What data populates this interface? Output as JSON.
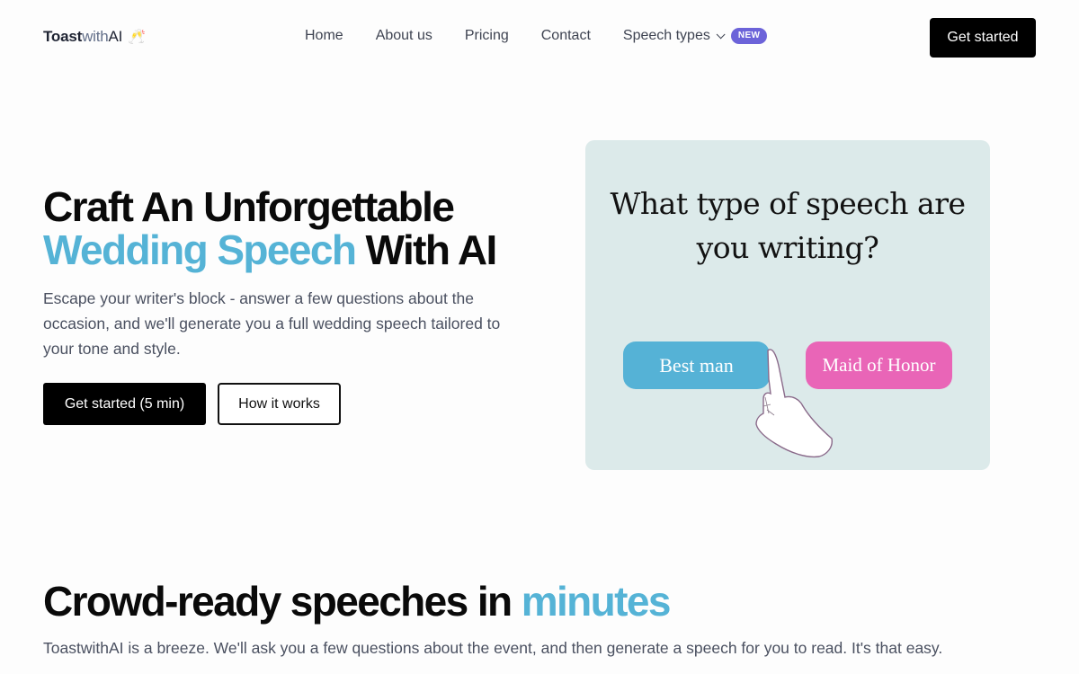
{
  "nav": {
    "logo": {
      "part1": "Toast",
      "part2": "with",
      "part3": "AI",
      "emoji": "🥂"
    },
    "links": [
      {
        "label": "Home"
      },
      {
        "label": "About us"
      },
      {
        "label": "Pricing"
      },
      {
        "label": "Contact"
      },
      {
        "label": "Speech types",
        "badge": "NEW",
        "has_dropdown": true
      }
    ],
    "cta_label": "Get started"
  },
  "hero": {
    "title_line1": "Craft An Unforgettable",
    "title_accent": "Wedding Speech",
    "title_line2_rest": " With AI",
    "subtitle": "Escape your writer's block - answer a few questions about the occasion, and we'll generate you a full wedding speech tailored to your tone and style.",
    "primary_button": "Get started (5 min)",
    "secondary_button": "How it works"
  },
  "illustration": {
    "question_line1": "What type of speech are",
    "question_line2": "you writing?",
    "choices": [
      {
        "label": "Best man",
        "color": "#55b2d6"
      },
      {
        "label": "Maid of Honor",
        "color": "#e965b7"
      }
    ],
    "background": "#dceaea"
  },
  "section2": {
    "title": "Crowd-ready speeches in ",
    "title_accent": "minutes",
    "subtitle": "ToastwithAI is a breeze. We'll ask you a few questions about the event, and then generate a speech for you to read. It's that easy."
  },
  "colors": {
    "accent": "#55b3d6",
    "badge": "#6c63d9",
    "primary": "#000000"
  }
}
